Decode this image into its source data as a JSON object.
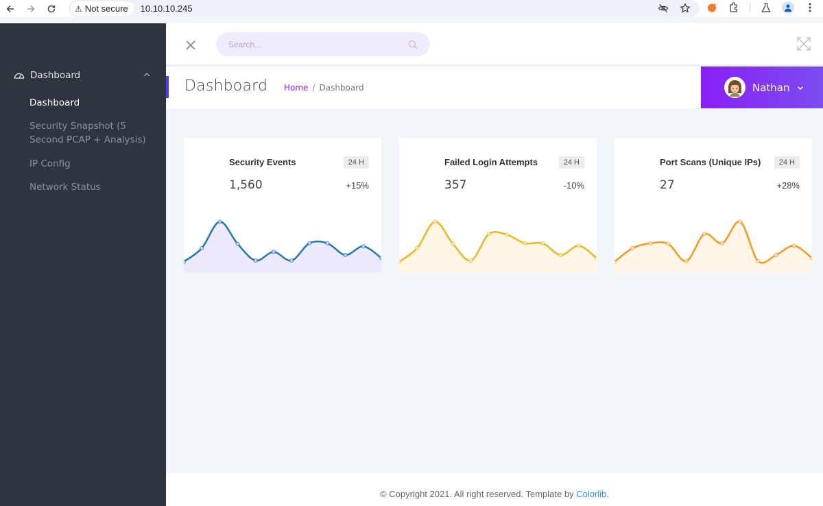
{
  "browser": {
    "security_label": "Not secure",
    "url": "10.10.10.245"
  },
  "sidebar": {
    "group_label": "Dashboard",
    "items": [
      {
        "label": "Dashboard",
        "active": true
      },
      {
        "label": "Security Snapshot (5 Second PCAP + Analysis)",
        "active": false
      },
      {
        "label": "IP Config",
        "active": false
      },
      {
        "label": "Network Status",
        "active": false
      }
    ]
  },
  "topbar": {
    "search_placeholder": "Search..."
  },
  "page": {
    "title": "Dashboard",
    "breadcrumb": {
      "home": "Home",
      "separator": "/",
      "current": "Dashboard"
    },
    "user_name": "Nathan"
  },
  "colors": {
    "accent": "#8a1ff5",
    "sidebar_bg": "#2f353e",
    "card1_line": "#1f77b4",
    "card1_fill": "#efe9fd",
    "card2_line": "#f0b51f",
    "card2_fill": "#fff6e6",
    "card3_line": "#f7981d",
    "card3_fill": "#fff6e9"
  },
  "cards": [
    {
      "title": "Security Events",
      "badge": "24 H",
      "value": "1,560",
      "change": "+15%"
    },
    {
      "title": "Failed Login Attempts",
      "badge": "24 H",
      "value": "357",
      "change": "-10%"
    },
    {
      "title": "Port Scans (Unique IPs)",
      "badge": "24 H",
      "value": "27",
      "change": "+28%"
    }
  ],
  "chart_data": [
    {
      "type": "area",
      "title": "Security Events",
      "x": [
        1,
        2,
        3,
        4,
        5,
        6,
        7,
        8,
        9,
        10,
        11,
        12
      ],
      "values": [
        18,
        40,
        83,
        47,
        20,
        34,
        20,
        48,
        48,
        29,
        43,
        24
      ],
      "ylim": [
        0,
        100
      ],
      "grid": false,
      "legend": "none"
    },
    {
      "type": "area",
      "title": "Failed Login Attempts",
      "x": [
        1,
        2,
        3,
        4,
        5,
        6,
        7,
        8,
        9,
        10,
        11,
        12
      ],
      "values": [
        18,
        40,
        83,
        47,
        20,
        63,
        62,
        48,
        48,
        29,
        44,
        24
      ],
      "ylim": [
        0,
        100
      ],
      "grid": false,
      "legend": "none"
    },
    {
      "type": "area",
      "title": "Port Scans (Unique IPs)",
      "x": [
        1,
        2,
        3,
        4,
        5,
        6,
        7,
        8,
        9,
        10,
        11,
        12
      ],
      "values": [
        18,
        40,
        48,
        47,
        19,
        63,
        48,
        83,
        19,
        29,
        44,
        24
      ],
      "ylim": [
        0,
        100
      ],
      "grid": false,
      "legend": "none"
    }
  ],
  "footer": {
    "text": "© Copyright 2021. All right reserved. Template by ",
    "link": "Colorlib",
    "suffix": "."
  }
}
